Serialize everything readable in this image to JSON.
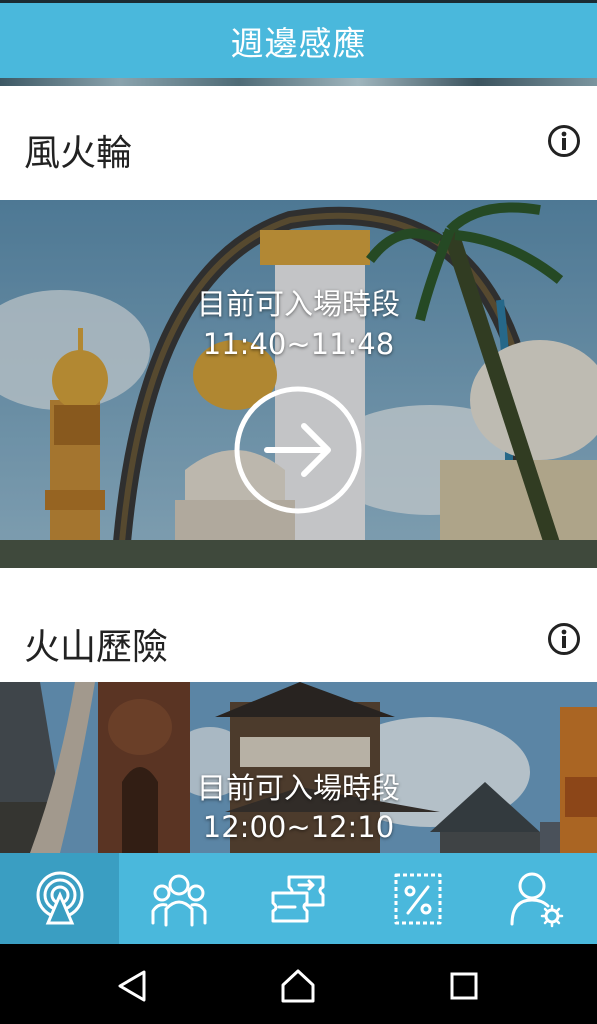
{
  "header": {
    "title": "週邊感應"
  },
  "rides": [
    {
      "name": "風火輪",
      "status_label": "目前可入場時段",
      "time_window": "11:40~11:48"
    },
    {
      "name": "火山歷險",
      "status_label": "目前可入場時段",
      "time_window": "12:00~12:10"
    }
  ],
  "tabbar": {
    "active_index": 0,
    "items": [
      {
        "icon": "nearby-signal-icon"
      },
      {
        "icon": "group-icon"
      },
      {
        "icon": "tickets-transfer-icon"
      },
      {
        "icon": "discount-coupon-icon"
      },
      {
        "icon": "user-settings-icon"
      }
    ]
  },
  "navbar": {
    "buttons": [
      "back-icon",
      "home-icon",
      "recents-icon"
    ]
  },
  "colors": {
    "primary": "#4ab8dc",
    "primary_dark": "#3a9ec2"
  }
}
